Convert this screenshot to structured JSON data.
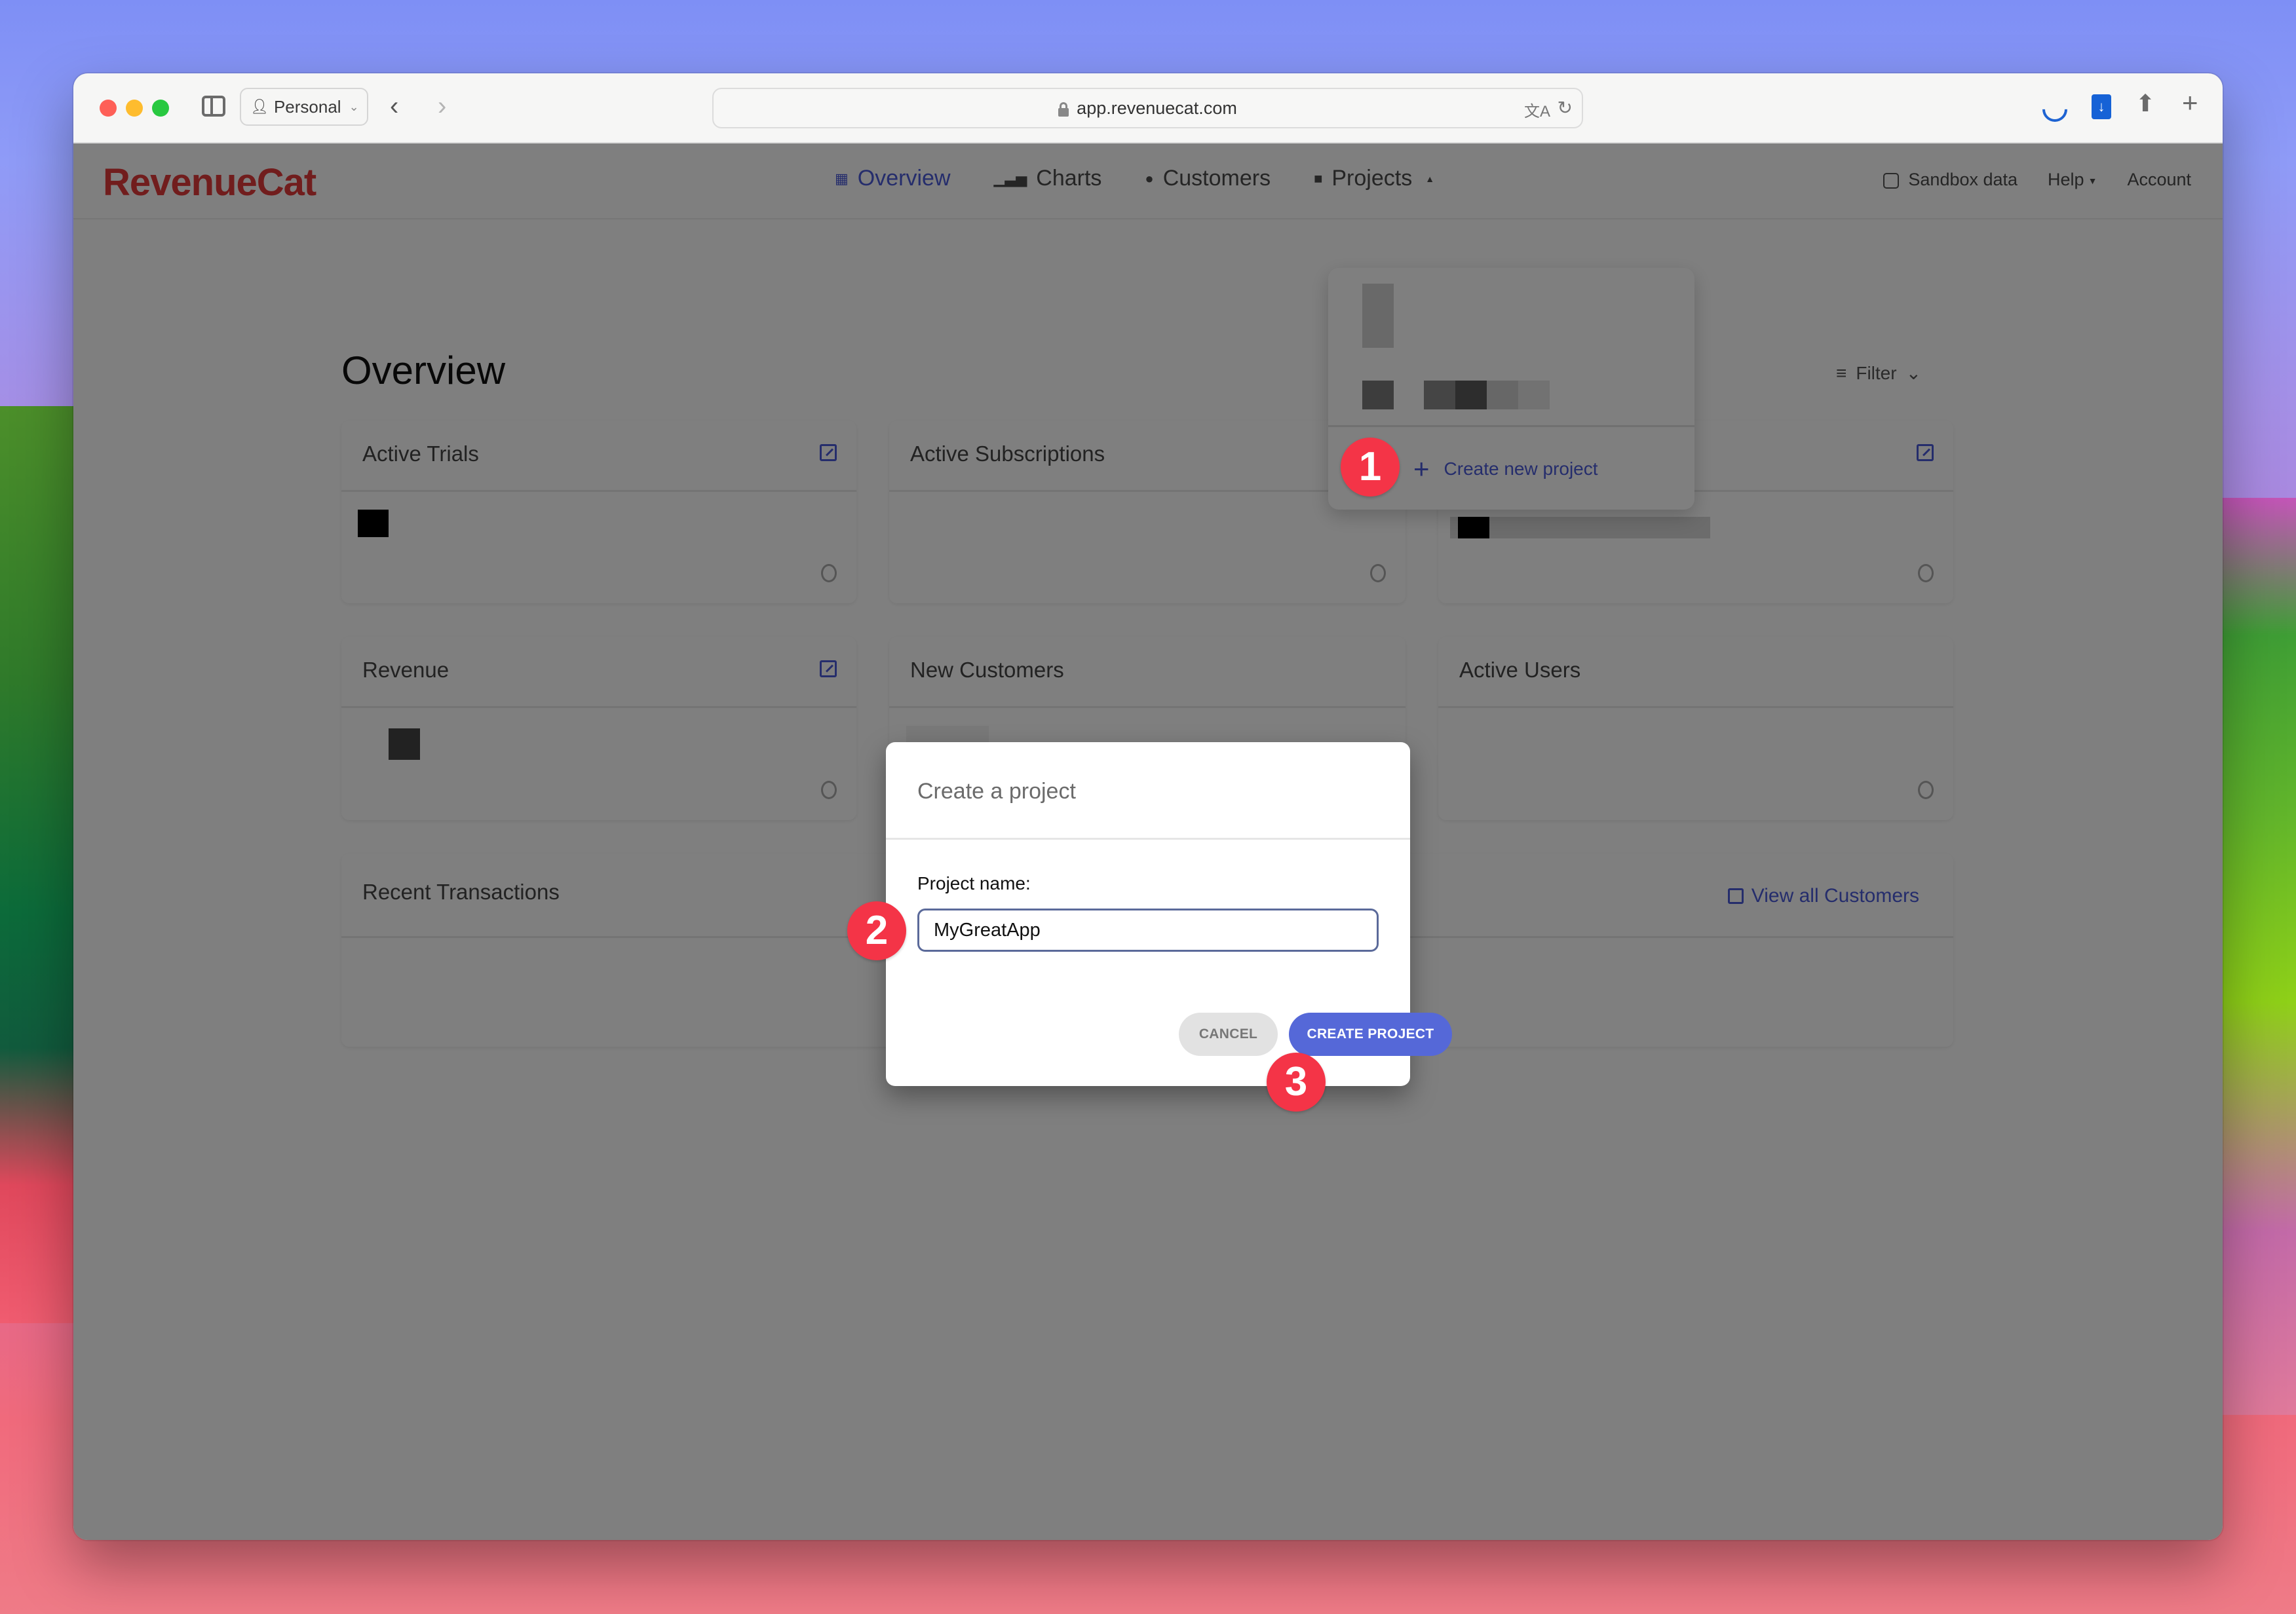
{
  "browser": {
    "profile_label": "Personal",
    "url": "app.revenuecat.com",
    "icons": {
      "sidebar": "sidebar-toggle-icon",
      "back": "chevron-left-icon",
      "forward": "chevron-right-icon",
      "lock": "lock-icon",
      "translate": "translate-icon",
      "reload": "reload-icon",
      "loading": "loading-spinner-icon",
      "extension": "bitwarden-extension-icon",
      "share": "share-icon",
      "new_tab": "plus-icon"
    }
  },
  "app": {
    "logo": "RevenueCat",
    "brand_color": "#e23b3b",
    "accent_color": "#4a5ad8",
    "nav": {
      "items": [
        {
          "label": "Overview",
          "icon": "dashboard-icon",
          "active": true
        },
        {
          "label": "Charts",
          "icon": "bar-chart-icon",
          "active": false
        },
        {
          "label": "Customers",
          "icon": "person-icon",
          "active": false
        },
        {
          "label": "Projects",
          "icon": "folder-icon",
          "active": false
        }
      ],
      "sandbox_label": "Sandbox data",
      "sandbox_checked": false,
      "help_label": "Help",
      "account_label": "Account"
    },
    "page_title": "Overview",
    "filter_label": "Filter",
    "cards": [
      {
        "title": "Active Trials",
        "has_link": true
      },
      {
        "title": "Active Subscriptions",
        "has_link": true
      },
      {
        "title": "",
        "has_link": true
      },
      {
        "title": "Revenue",
        "has_link": true
      },
      {
        "title": "New Customers",
        "has_link": false
      },
      {
        "title": "Active Users",
        "has_link": false
      }
    ],
    "recent_transactions": {
      "title": "Recent Transactions",
      "link_label": "View all Customers"
    },
    "projects_dropdown": {
      "create_label": "Create new project"
    }
  },
  "modal": {
    "title": "Create a project",
    "field_label": "Project name:",
    "field_value": "MyGreatApp",
    "cancel_label": "CANCEL",
    "create_label": "CREATE PROJECT"
  },
  "steps": [
    "1",
    "2",
    "3"
  ],
  "step_color": "#f43447"
}
